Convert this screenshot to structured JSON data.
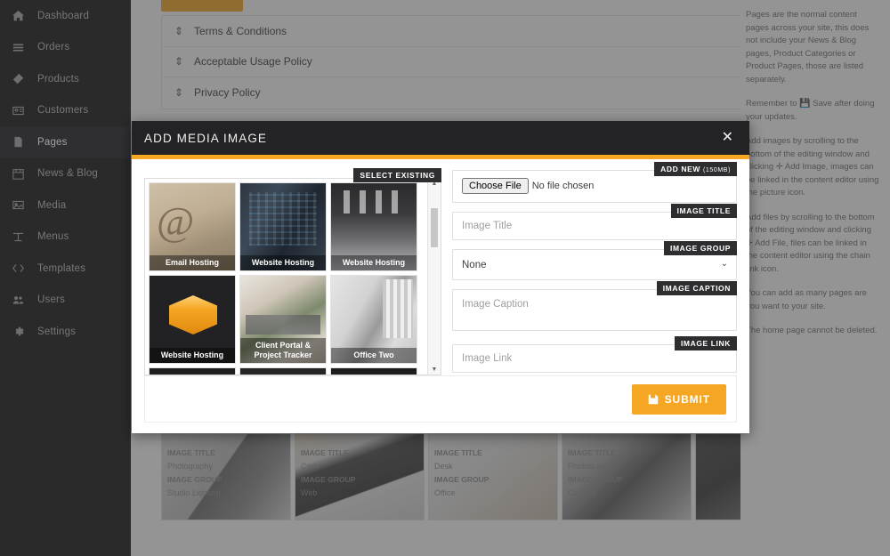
{
  "sidebar": {
    "items": [
      {
        "label": "Dashboard",
        "icon": "home-icon",
        "active": false
      },
      {
        "label": "Orders",
        "icon": "orders-icon",
        "active": false
      },
      {
        "label": "Products",
        "icon": "products-icon",
        "active": false
      },
      {
        "label": "Customers",
        "icon": "customers-icon",
        "active": false
      },
      {
        "label": "Pages",
        "icon": "pages-icon",
        "active": true
      },
      {
        "label": "News & Blog",
        "icon": "news-icon",
        "active": false
      },
      {
        "label": "Media",
        "icon": "media-icon",
        "active": false
      },
      {
        "label": "Menus",
        "icon": "menus-icon",
        "active": false
      },
      {
        "label": "Templates",
        "icon": "templates-icon",
        "active": false
      },
      {
        "label": "Users",
        "icon": "users-icon",
        "active": false
      },
      {
        "label": "Settings",
        "icon": "settings-icon",
        "active": false
      }
    ]
  },
  "background": {
    "page_rows": [
      {
        "title": "Terms & Conditions"
      },
      {
        "title": "Acceptable Usage Policy"
      },
      {
        "title": "Privacy Policy"
      }
    ],
    "image_cards": [
      {
        "title_label": "IMAGE TITLE",
        "title_value": "Photography",
        "group_label": "IMAGE GROUP",
        "group_value": "Studio Lighting"
      },
      {
        "title_label": "IMAGE TITLE",
        "title_value": "Code",
        "group_label": "IMAGE GROUP",
        "group_value": "Web"
      },
      {
        "title_label": "IMAGE TITLE",
        "title_value": "Desk",
        "group_label": "IMAGE GROUP",
        "group_value": "Office"
      },
      {
        "title_label": "IMAGE TITLE",
        "title_value": "Photography",
        "group_label": "IMAGE GROUP",
        "group_value": "Camera"
      }
    ]
  },
  "help": {
    "paragraph_1": "Pages are the normal content pages across your site, this does not include your News & Blog pages, Product Categories or Product Pages, those are listed separately.",
    "paragraph_2_before": "Remember to",
    "paragraph_2_after": "Save after doing your updates.",
    "paragraph_3": "Add images by scrolling to the bottom of the editing window and clicking ✛ Add Image, images can be linked in the content editor using the picture icon.",
    "paragraph_4": "Add files by scrolling to the bottom of the editing window and clicking ✛ Add File, files can be linked in the content editor using the chain link icon.",
    "paragraph_5": "You can add as many pages are you want to your site.",
    "paragraph_6": "The home page cannot be deleted."
  },
  "modal": {
    "title": "ADD MEDIA IMAGE",
    "close_label": "✕",
    "select_existing_badge": "SELECT EXISTING",
    "gallery": [
      {
        "caption": "Email Hosting",
        "style": "t1"
      },
      {
        "caption": "Website Hosting",
        "style": "t2"
      },
      {
        "caption": "Website Hosting",
        "style": "t3"
      },
      {
        "caption": "Website Hosting",
        "style": "t4"
      },
      {
        "caption": "Client Portal & Project Tracker",
        "style": "t5"
      },
      {
        "caption": "Office Two",
        "style": "t6"
      },
      {
        "caption": "",
        "style": "t7"
      },
      {
        "caption": "",
        "style": "t8"
      },
      {
        "caption": "",
        "style": "t9"
      }
    ],
    "fields": {
      "add_new": {
        "badge": "ADD NEW",
        "badge_sub": "(150MB)",
        "button_label": "Choose Files",
        "status": "No file chosen"
      },
      "image_title": {
        "badge": "IMAGE TITLE",
        "placeholder": "Image Title",
        "value": ""
      },
      "image_group": {
        "badge": "IMAGE GROUP",
        "selected": "None",
        "options": [
          "None"
        ]
      },
      "image_caption": {
        "badge": "IMAGE CAPTION",
        "placeholder": "Image Caption",
        "value": ""
      },
      "image_link": {
        "badge": "IMAGE LINK",
        "placeholder": "Image Link",
        "value": ""
      }
    },
    "submit_label": "SUBMIT"
  },
  "colors": {
    "accent": "#f5a623",
    "sidebar_bg": "#2b2b2d",
    "modal_header_bg": "#232325",
    "badge_bg": "#2e2e30",
    "trash": "#9b2d2d"
  }
}
